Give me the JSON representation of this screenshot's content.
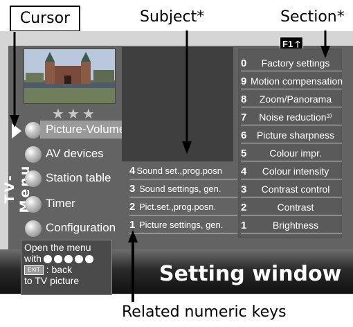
{
  "callouts": {
    "cursor": "Cursor",
    "subject": "Subject*",
    "section": "Section*",
    "related_keys": "Related numeric keys"
  },
  "screen": {
    "sidebar_title": "TV-Menu",
    "stars": "★★★",
    "menu": [
      {
        "label": "Picture-Volume",
        "selected": true
      },
      {
        "label": "AV devices"
      },
      {
        "label": "Station table"
      },
      {
        "label": "Timer"
      },
      {
        "label": "Configuration"
      }
    ],
    "help": {
      "line1": "Open the menu",
      "line2": "with",
      "exit_key": "EXIT",
      "line3": ": back",
      "line4": "to TV picture"
    },
    "f1_label": "F1 🡑",
    "subject_items": [
      {
        "num": "4",
        "label": "Sound set.,prog.posn"
      },
      {
        "num": "3",
        "label": "Sound settings, gen."
      },
      {
        "num": "2",
        "label": "Pict.set.,prog.posn."
      },
      {
        "num": "1",
        "label": "Picture settings, gen."
      }
    ],
    "section_items": [
      {
        "num": "0",
        "label": "Factory settings"
      },
      {
        "num": "9",
        "label": "Motion compensation"
      },
      {
        "num": "8",
        "label": "Zoom/Panorama"
      },
      {
        "num": "7",
        "label": "Noise reduction³⁾"
      },
      {
        "num": "6",
        "label": "Picture sharpness"
      },
      {
        "num": "5",
        "label": "Colour impr."
      },
      {
        "num": "4",
        "label": "Colour intensity"
      },
      {
        "num": "3",
        "label": "Contrast control"
      },
      {
        "num": "2",
        "label": "Contrast"
      },
      {
        "num": "1",
        "label": "Brightness"
      }
    ],
    "setting_window": "Setting window"
  }
}
